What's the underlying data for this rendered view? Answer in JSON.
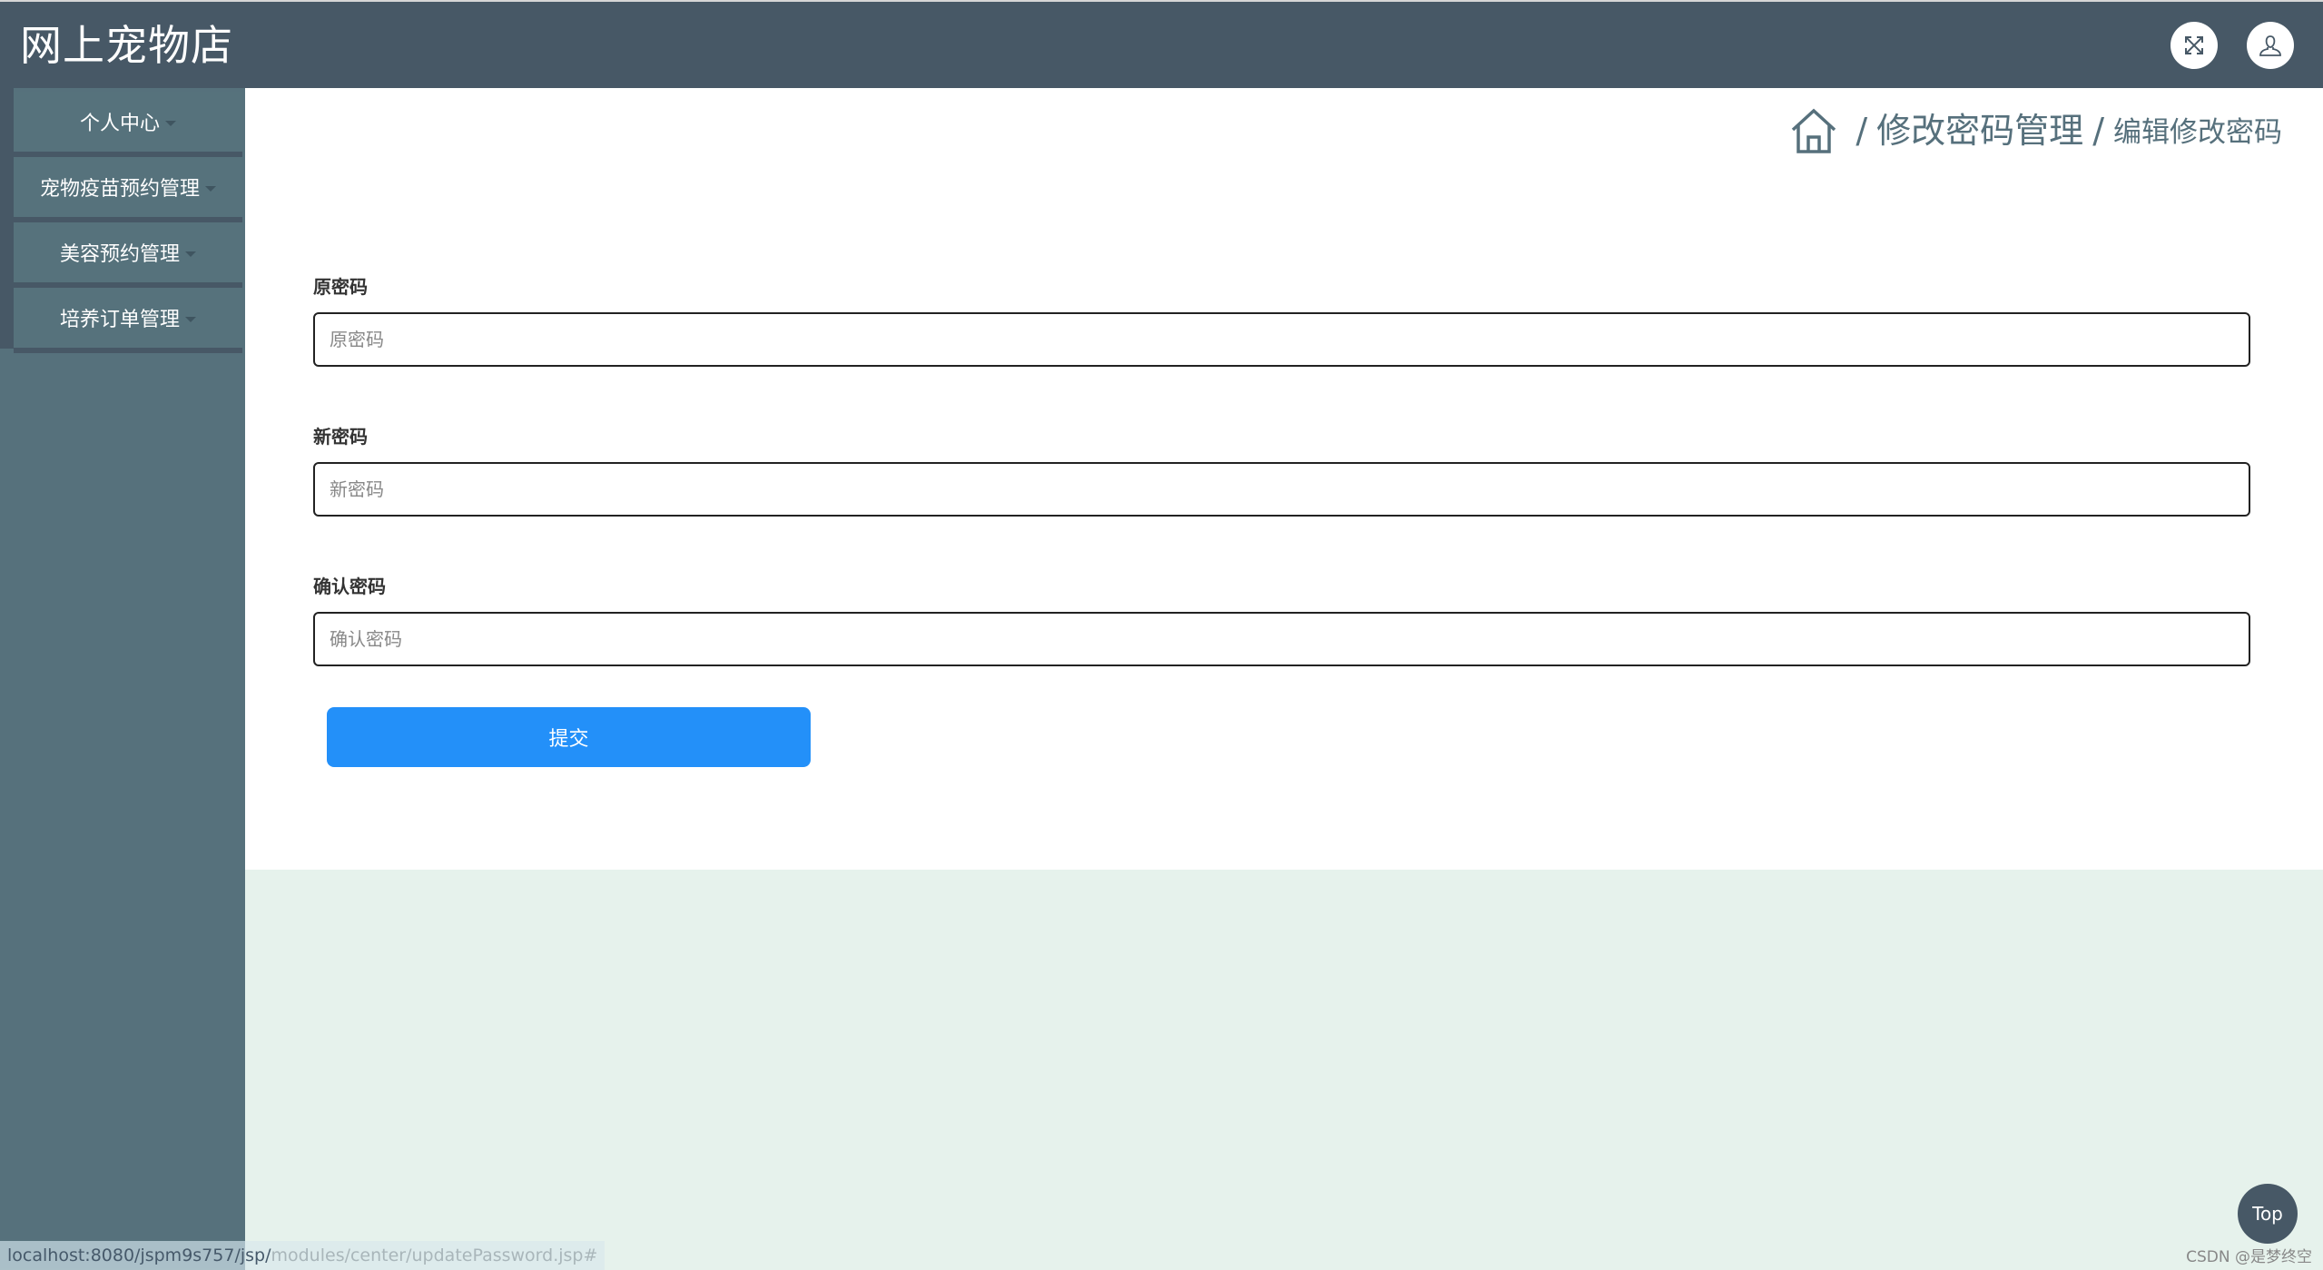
{
  "app": {
    "title": "网上宠物店"
  },
  "header": {
    "fullscreen_icon": "expand-arrows-icon",
    "user_icon": "user-icon"
  },
  "sidebar": {
    "items": [
      {
        "label": "个人中心",
        "icon": "caret-down-icon"
      },
      {
        "label": "宠物疫苗预约管理",
        "icon": "caret-down-icon"
      },
      {
        "label": "美容预约管理",
        "icon": "caret-down-icon"
      },
      {
        "label": "培养订单管理",
        "icon": "caret-down-icon"
      }
    ]
  },
  "breadcrumb": {
    "home_icon": "home-icon",
    "separator": "/",
    "level1": "修改密码管理",
    "level2": "编辑修改密码"
  },
  "form": {
    "fields": [
      {
        "label": "原密码",
        "placeholder": "原密码",
        "value": ""
      },
      {
        "label": "新密码",
        "placeholder": "新密码",
        "value": ""
      },
      {
        "label": "确认密码",
        "placeholder": "确认密码",
        "value": ""
      }
    ],
    "submit_label": "提交"
  },
  "top_button": "Top",
  "watermark": "CSDN @是梦终空",
  "status_url": {
    "prefix": "localhost:8080/jspm9s757/jsp/",
    "suffix": "modules/center/updatePassword.jsp#"
  },
  "colors": {
    "header_bg": "#475866",
    "sidebar_bg": "#56717c",
    "accent_button": "#2390f9",
    "page_bg": "#e6f2ec"
  }
}
